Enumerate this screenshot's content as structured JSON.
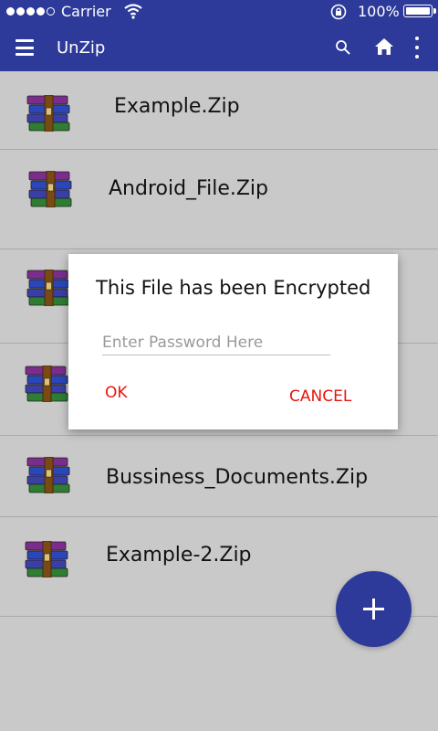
{
  "status_bar": {
    "carrier": "Carrier",
    "battery": "100%"
  },
  "app_bar": {
    "title": "UnZip",
    "icons": [
      "menu-icon",
      "search-icon",
      "home-icon",
      "more-vert-icon"
    ]
  },
  "files": [
    {
      "name": "Example.Zip",
      "icon": "winrar-archive-icon"
    },
    {
      "name": "Android_File.Zip",
      "icon": "winrar-archive-icon"
    },
    {
      "name": "",
      "icon": "winrar-archive-icon"
    },
    {
      "name": "",
      "icon": "winrar-archive-icon"
    },
    {
      "name": "Bussiness_Documents.Zip",
      "icon": "winrar-archive-icon"
    },
    {
      "name": "Example-2.Zip",
      "icon": "winrar-archive-icon"
    }
  ],
  "dialog": {
    "title": "This File has been Encrypted",
    "password_placeholder": "Enter Password Here",
    "password_value": "",
    "ok_label": "OK",
    "cancel_label": "CANCEL"
  },
  "fab": {
    "icon": "plus-icon"
  },
  "colors": {
    "primary": "#2d3a99",
    "background": "#c9c9c9",
    "dialog_action": "#e8150d"
  }
}
